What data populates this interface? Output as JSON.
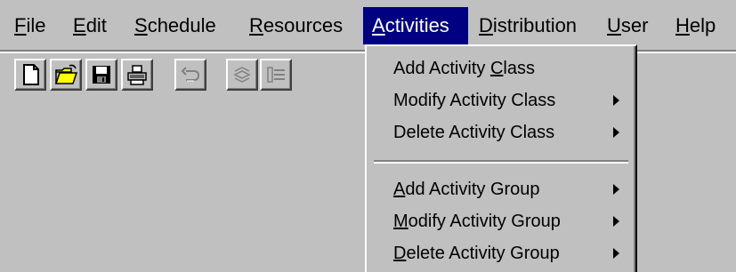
{
  "menubar": {
    "items": [
      {
        "pre": "",
        "mnemonic": "F",
        "post": "ile"
      },
      {
        "pre": "",
        "mnemonic": "E",
        "post": "dit"
      },
      {
        "pre": "",
        "mnemonic": "S",
        "post": "chedule"
      },
      {
        "pre": "",
        "mnemonic": "R",
        "post": "esources"
      },
      {
        "pre": "",
        "mnemonic": "A",
        "post": "ctivities"
      },
      {
        "pre": "",
        "mnemonic": "D",
        "post": "istribution"
      },
      {
        "pre": "",
        "mnemonic": "U",
        "post": "ser"
      },
      {
        "pre": "",
        "mnemonic": "H",
        "post": "elp"
      }
    ],
    "active_index": 4
  },
  "toolbar": {
    "buttons": [
      {
        "icon": "new-file-icon",
        "enabled": true
      },
      {
        "icon": "open-folder-icon",
        "enabled": true
      },
      {
        "icon": "save-disk-icon",
        "enabled": true
      },
      {
        "icon": "print-icon",
        "enabled": true
      },
      {
        "icon": "undo-icon",
        "enabled": false
      },
      {
        "icon": "stack-icon",
        "enabled": false
      },
      {
        "icon": "list-icon",
        "enabled": false
      }
    ]
  },
  "dropdown": {
    "items": [
      {
        "pre": "Add Activity ",
        "mnemonic": "C",
        "post": "lass",
        "submenu": false
      },
      {
        "pre": "Modify Activity Class",
        "mnemonic": "",
        "post": "",
        "submenu": true
      },
      {
        "pre": "Delete Activity Class",
        "mnemonic": "",
        "post": "",
        "submenu": true
      },
      {
        "pre": "",
        "mnemonic": "A",
        "post": "dd Activity Group",
        "submenu": true
      },
      {
        "pre": "",
        "mnemonic": "M",
        "post": "odify Activity Group",
        "submenu": true
      },
      {
        "pre": "",
        "mnemonic": "D",
        "post": "elete Activity Group",
        "submenu": true
      }
    ]
  },
  "colors": {
    "face": "#c0c0c0",
    "highlight": "#000080",
    "shadow": "#808080"
  }
}
